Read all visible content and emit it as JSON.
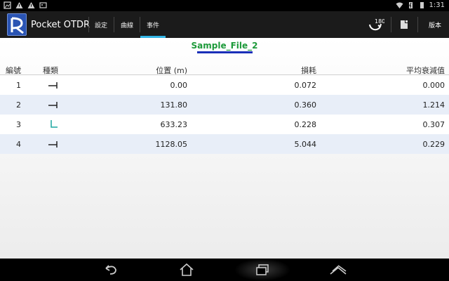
{
  "status_bar": {
    "time": "1:31"
  },
  "action_bar": {
    "app_title": "Pocket OTDR",
    "tabs": [
      {
        "label": "設定",
        "selected": false
      },
      {
        "label": "曲線",
        "selected": false
      },
      {
        "label": "事件",
        "selected": true
      }
    ],
    "rotate_badge": "180",
    "version_label": "版本"
  },
  "file": {
    "name": "Sample_File_2"
  },
  "table": {
    "headers": {
      "index": "編號",
      "type": "種類",
      "position": "位置 (m)",
      "loss": "損耗",
      "attenuation": "平均衰減值"
    },
    "rows": [
      {
        "index": "1",
        "type": "non-reflective-event-icon",
        "position": "0.00",
        "loss": "0.072",
        "attenuation": "0.000"
      },
      {
        "index": "2",
        "type": "non-reflective-event-icon",
        "position": "131.80",
        "loss": "0.360",
        "attenuation": "1.214"
      },
      {
        "index": "3",
        "type": "reflective-event-icon",
        "position": "633.23",
        "loss": "0.228",
        "attenuation": "0.307"
      },
      {
        "index": "4",
        "type": "non-reflective-event-icon",
        "position": "1128.05",
        "loss": "5.044",
        "attenuation": "0.229"
      }
    ]
  },
  "colors": {
    "accent": "#33b5e5",
    "file_title": "#1d9a3a",
    "underline": "#1a2fb8",
    "reflective_icon": "#1aa6a0"
  }
}
